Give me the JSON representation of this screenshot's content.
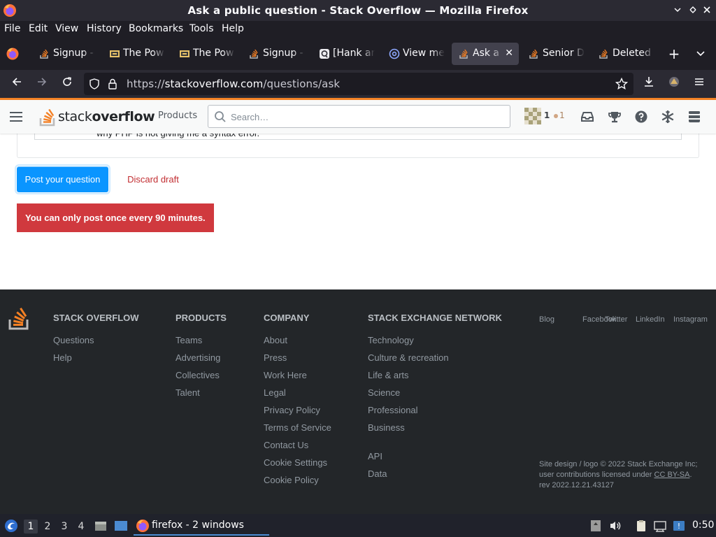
{
  "window": {
    "title": "Ask a public question - Stack Overflow — Mozilla Firefox",
    "controls": [
      "minimize",
      "maximize",
      "close"
    ]
  },
  "menubar": {
    "items": [
      "File",
      "Edit",
      "View",
      "History",
      "Bookmarks",
      "Tools",
      "Help"
    ]
  },
  "tabs": [
    {
      "label": "Signup -",
      "icon": "stackoverflow-favicon"
    },
    {
      "label": "The Pow",
      "icon": "image-favicon"
    },
    {
      "label": "The Pow",
      "icon": "image-favicon"
    },
    {
      "label": "Signup -",
      "icon": "stackoverflow-favicon"
    },
    {
      "label": "[Hank ar",
      "icon": "q-favicon"
    },
    {
      "label": "View me",
      "icon": "at-favicon"
    },
    {
      "label": "Ask a p",
      "icon": "stackoverflow-favicon",
      "active": true
    },
    {
      "label": "Senior D",
      "icon": "stackoverflow-favicon"
    },
    {
      "label": "Deleted",
      "icon": "stackoverflow-favicon"
    }
  ],
  "navbar": {
    "url_scheme": "https://",
    "url_host": "stackoverflow.com",
    "url_path": "/questions/ask"
  },
  "so_header": {
    "logo_light": "stack",
    "logo_bold": "overflow",
    "products": "Products",
    "search_placeholder": "Search…",
    "reputation": "1",
    "bronze_badges": "1"
  },
  "page": {
    "preview_text": "why PHP is not giving me a syntax error.",
    "post_button": "Post your question",
    "discard_button": "Discard draft",
    "error_message": "You can only post once every 90 minutes."
  },
  "footer": {
    "columns": [
      {
        "heading": "STACK OVERFLOW",
        "links": [
          "Questions",
          "Help"
        ]
      },
      {
        "heading": "PRODUCTS",
        "links": [
          "Teams",
          "Advertising",
          "Collectives",
          "Talent"
        ]
      },
      {
        "heading": "COMPANY",
        "links": [
          "About",
          "Press",
          "Work Here",
          "Legal",
          "Privacy Policy",
          "Terms of Service",
          "Contact Us",
          "Cookie Settings",
          "Cookie Policy"
        ]
      },
      {
        "heading": "STACK EXCHANGE NETWORK",
        "links": [
          "Technology",
          "Culture & recreation",
          "Life & arts",
          "Science",
          "Professional",
          "Business"
        ],
        "links2": [
          "API",
          "Data"
        ]
      }
    ],
    "social": [
      "Blog",
      "Facebook",
      "Twitter",
      "LinkedIn",
      "Instagram"
    ],
    "copyright_1": "Site design / logo © 2022 Stack Exchange Inc;",
    "copyright_2": "user contributions licensed under",
    "license": "CC BY-SA",
    "copyright_3": ".",
    "revision": "rev 2022.12.21.43127"
  },
  "taskbar": {
    "workspaces": [
      "1",
      "2",
      "3",
      "4"
    ],
    "active_workspace": "1",
    "task_label": "firefox - 2 windows",
    "clock": "0:50"
  },
  "colors": {
    "so_orange": "#f48225",
    "so_blue_button": "#0a95ff",
    "error_red": "#d0393e",
    "discard_red": "#c22e32",
    "footer_bg": "#232629",
    "firefox_chrome": "#2b2a33"
  }
}
